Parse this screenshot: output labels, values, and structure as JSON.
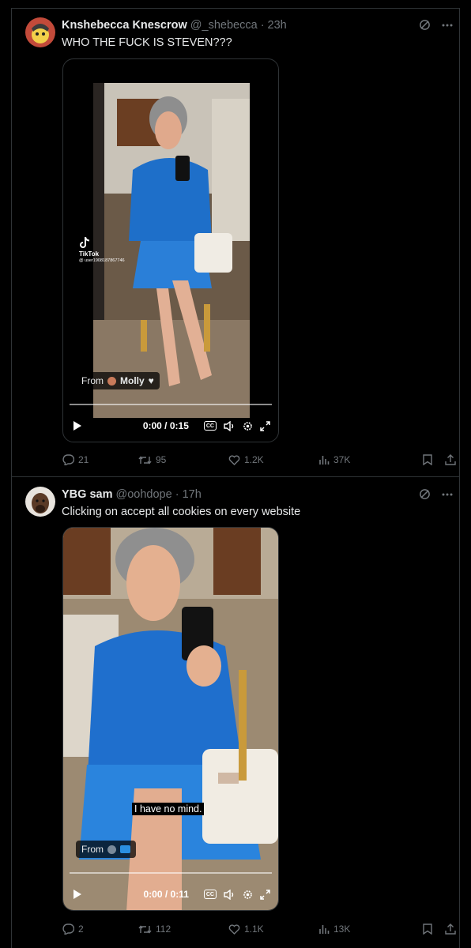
{
  "tweets": [
    {
      "name": "Knshebecca Knescrow",
      "handle": "@_shebecca",
      "time": "· 23h",
      "text": "WHO THE FUCK IS STEVEN???",
      "watermark_brand": "TikTok",
      "watermark_user": "@ user1908187867746",
      "from_label": "From",
      "from_name": "Molly",
      "video_time": "0:00 / 0:15",
      "cc_label": "CC",
      "stats": {
        "replies": "21",
        "reposts": "95",
        "likes": "1.2K",
        "views": "37K"
      }
    },
    {
      "name": "YBG sam",
      "handle": "@oohdope",
      "time": "· 17h",
      "text": "Clicking on accept all cookies on every website",
      "caption": "I have no mind.",
      "from_label": "From",
      "video_time": "0:00 / 0:11",
      "cc_label": "CC",
      "stats": {
        "replies": "2",
        "reposts": "112",
        "likes": "1.1K",
        "views": "13K"
      }
    }
  ],
  "colors": {
    "background": "#000000",
    "text": "#e7e9ea",
    "muted": "#71767b",
    "border": "#2f3336"
  },
  "icons": [
    "grok-icon",
    "more-icon",
    "play-icon",
    "cc-icon",
    "volume-icon",
    "settings-icon",
    "fullscreen-icon",
    "reply-icon",
    "repost-icon",
    "like-icon",
    "views-icon",
    "bookmark-icon",
    "share-icon"
  ]
}
